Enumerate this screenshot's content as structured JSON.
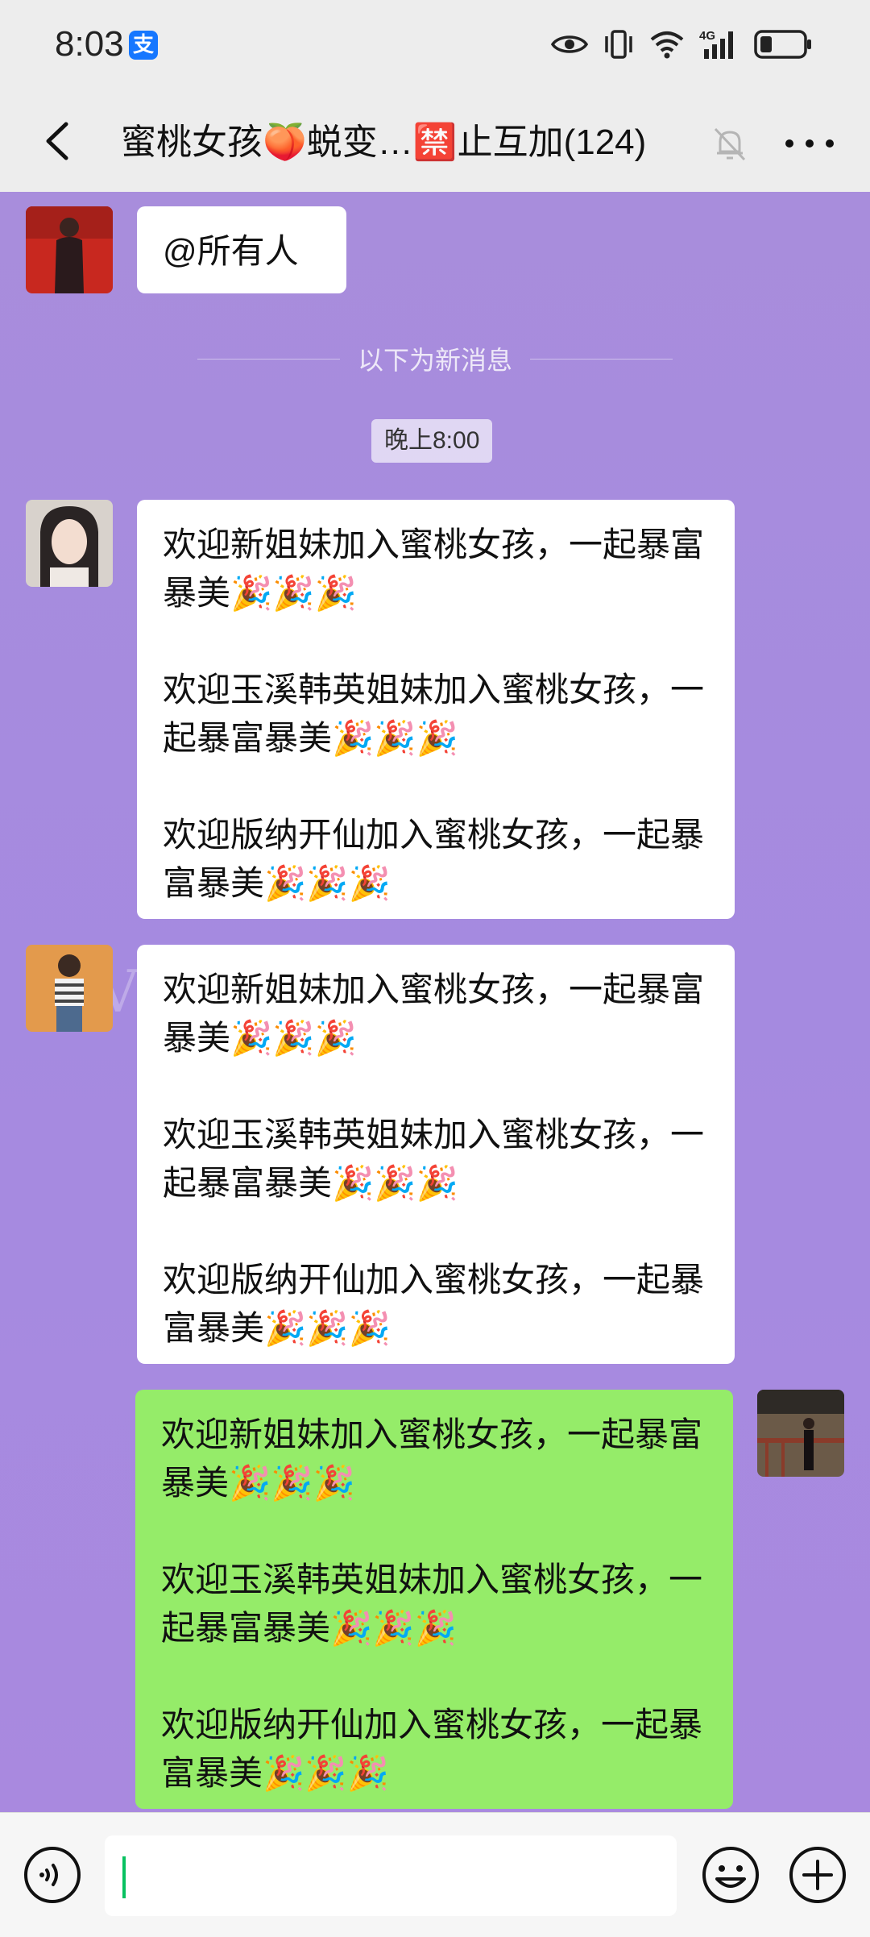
{
  "status_bar": {
    "time": "8:03",
    "alipay_glyph": "支",
    "icons": [
      "eye-icon",
      "vibrate-icon",
      "wifi-icon",
      "4g-signal-icon",
      "battery-icon"
    ],
    "network_label": "4G"
  },
  "header": {
    "title": "蜜桃女孩🍑蜕变…🈲止互加(124)",
    "icons": [
      "back-icon",
      "mute-icon",
      "more-icon"
    ]
  },
  "chat": {
    "mention_message": "@所有人",
    "new_messages_divider": "以下为新消息",
    "timestamp": "晚上8:00",
    "watermark": "Vety",
    "messages": [
      {
        "side": "left",
        "lines": [
          "欢迎新姐妹加入蜜桃女孩，一起暴富暴美🎉🎉🎉",
          "欢迎玉溪韩英姐妹加入蜜桃女孩，一起暴富暴美🎉🎉🎉",
          "欢迎版纳开仙加入蜜桃女孩，一起暴富暴美🎉🎉🎉"
        ]
      },
      {
        "side": "left",
        "lines": [
          "欢迎新姐妹加入蜜桃女孩，一起暴富暴美🎉🎉🎉",
          "欢迎玉溪韩英姐妹加入蜜桃女孩，一起暴富暴美🎉🎉🎉",
          "欢迎版纳开仙加入蜜桃女孩，一起暴富暴美🎉🎉🎉"
        ]
      },
      {
        "side": "right",
        "lines": [
          "欢迎新姐妹加入蜜桃女孩，一起暴富暴美🎉🎉🎉",
          "欢迎玉溪韩英姐妹加入蜜桃女孩，一起暴富暴美🎉🎉🎉",
          "欢迎版纳开仙加入蜜桃女孩，一起暴富暴美🎉🎉🎉"
        ]
      }
    ]
  },
  "input_bar": {
    "text_value": "",
    "icons": [
      "voice-icon",
      "emoji-icon",
      "plus-icon"
    ]
  },
  "colors": {
    "chat_background": "#a88ddc",
    "self_bubble": "#95ec69",
    "other_bubble": "#ffffff",
    "caret": "#07c160"
  }
}
